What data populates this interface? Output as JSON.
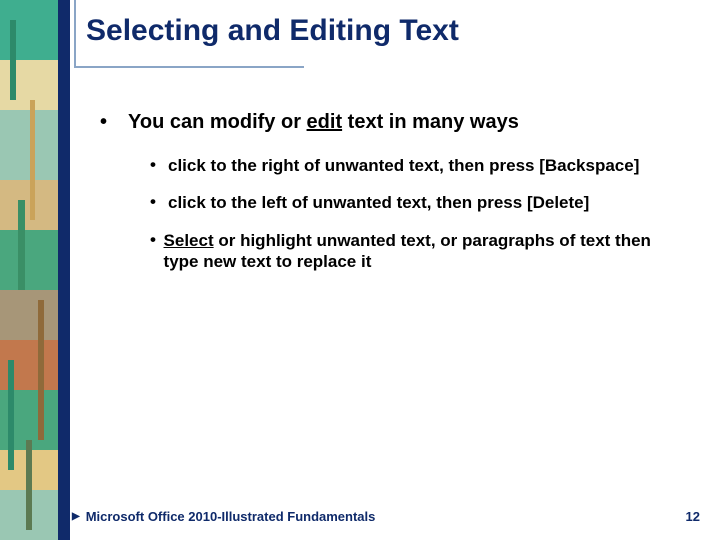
{
  "title": "Selecting and Editing Text",
  "bullet_level1": {
    "text_before": "You can modify or ",
    "underlined": "edit",
    "text_after": " text in many ways"
  },
  "bullets_level2": [
    {
      "underlined": "",
      "text": "click to the right of unwanted text, then press [Backspace]"
    },
    {
      "underlined": "",
      "text": "click to the left of unwanted text, then press [Delete]"
    },
    {
      "underlined": "Select",
      "text": " or highlight unwanted text,  or paragraphs of text then type new text to replace it"
    }
  ],
  "footer": {
    "left": "Microsoft Office 2010-Illustrated Fundamentals",
    "page": "12"
  },
  "sidebar_colors": {
    "t1": "#3fae8f",
    "t2": "#e6d9a4",
    "t3": "#9ac7b3",
    "t4": "#d4b982",
    "t5": "#c2784d",
    "t6": "#a79678",
    "t7": "#4aa77e",
    "t8": "#e3c884"
  }
}
